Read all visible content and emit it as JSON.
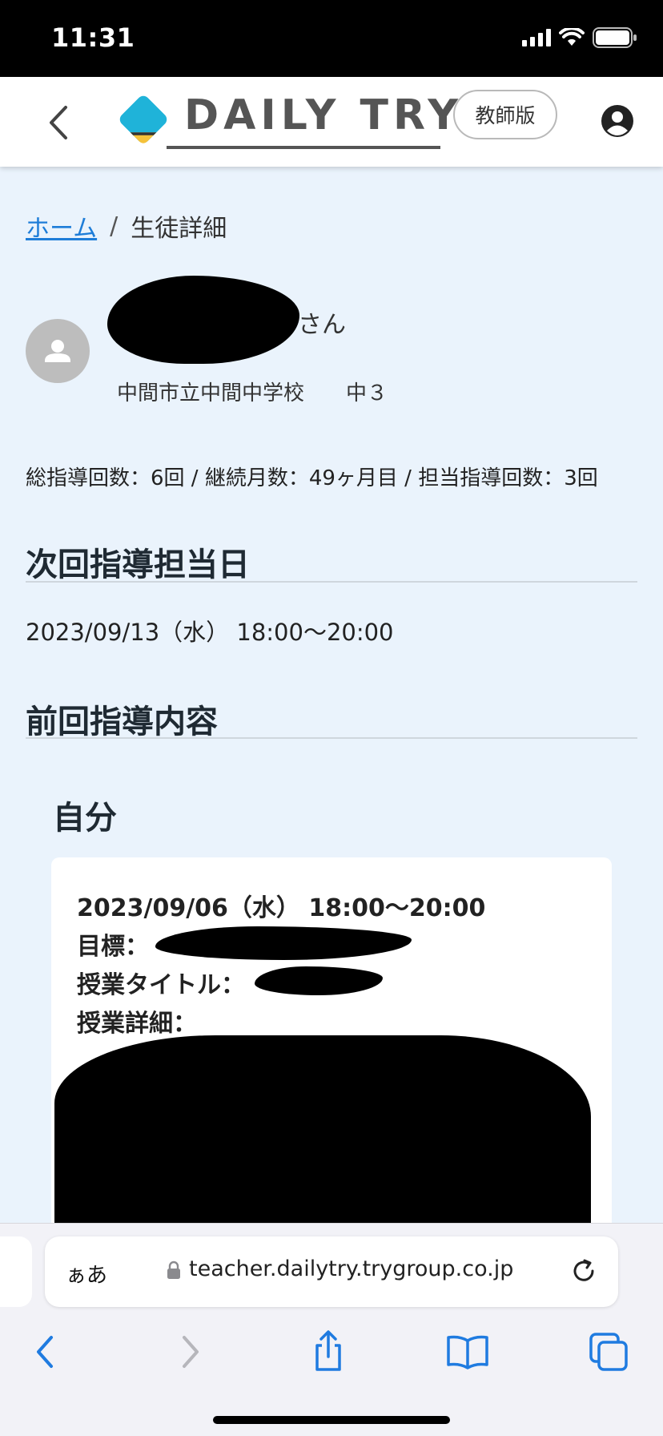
{
  "status_bar": {
    "time": "11:31"
  },
  "header": {
    "logo_text": "DAILY TRY",
    "teacher_badge": "教師版"
  },
  "breadcrumb": {
    "home": "ホーム",
    "separator": "/",
    "current": "生徒詳細"
  },
  "student": {
    "name_suffix": "さん",
    "school": "中間市立中間中学校　　中３"
  },
  "stats": "総指導回数：6回 / 継続月数：49ヶ月目 / 担当指導回数：3回",
  "next_section": {
    "title": "次回指導担当日",
    "datetime": "2023/09/13（水） 18:00〜20:00"
  },
  "previous_section": {
    "title": "前回指導内容",
    "subtitle": "自分",
    "card": {
      "datetime": "2023/09/06（水） 18:00〜20:00",
      "goal_label": "目標：",
      "lesson_title_label": "授業タイトル：",
      "lesson_detail_label": "授業詳細："
    }
  },
  "browser": {
    "text_size_label": "ぁあ",
    "url": "teacher.dailytry.trygroup.co.jp"
  },
  "colors": {
    "link": "#1e7dd8",
    "page_bg": "#eaf3fc",
    "logo_blue": "#1fb3d9",
    "logo_yellow": "#f5c23a",
    "ios_blue": "#1f7be0"
  }
}
